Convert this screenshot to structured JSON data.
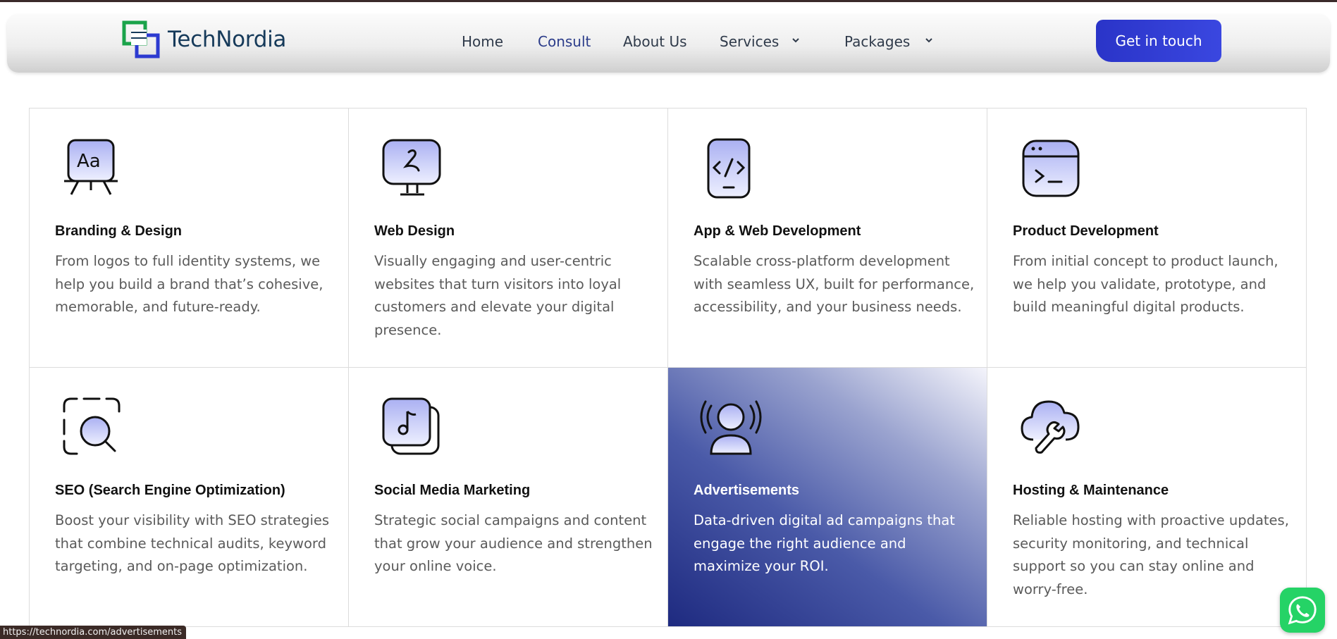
{
  "brand": {
    "name": "TechNordia"
  },
  "nav": {
    "items": [
      {
        "label": "Home",
        "active": false,
        "dropdown": false
      },
      {
        "label": "Consult",
        "active": true,
        "dropdown": false
      },
      {
        "label": "About Us",
        "active": false,
        "dropdown": false
      },
      {
        "label": "Services",
        "active": false,
        "dropdown": true
      },
      {
        "label": "Packages",
        "active": false,
        "dropdown": true
      }
    ],
    "cta_label": "Get in touch"
  },
  "services": [
    {
      "icon": "presentation-board-icon",
      "title": "Branding & Design",
      "description": "From logos to full identity systems, we help you build a brand that’s cohesive, memorable, and future-ready."
    },
    {
      "icon": "monitor-icon",
      "title": "Web Design",
      "description": "Visually engaging and user-centric websites that turn visitors into loyal customers and elevate your digital presence."
    },
    {
      "icon": "mobile-code-icon",
      "title": "App & Web Development",
      "description": "Scalable cross-platform development with seamless UX, built for performance, accessibility, and your business needs."
    },
    {
      "icon": "terminal-window-icon",
      "title": "Product Development",
      "description": "From initial concept to product launch, we help you validate, prototype, and build meaningful digital products."
    },
    {
      "icon": "scan-search-icon",
      "title": "SEO (Search Engine Optimization)",
      "description": "Boost your visibility with SEO strategies that combine technical audits, keyword targeting, and on-page optimization."
    },
    {
      "icon": "music-note-icon",
      "title": "Social Media Marketing",
      "description": "Strategic social campaigns and content that grow your audience and strengthen your online voice."
    },
    {
      "icon": "broadcast-user-icon",
      "title": "Advertisements",
      "description": "Data-driven digital ad campaigns that engage the right audience and maximize your ROI.",
      "highlighted": true
    },
    {
      "icon": "cloud-wrench-icon",
      "title": "Hosting & Maintenance",
      "description": "Reliable hosting with proactive updates, security monitoring, and technical support so you can stay online and worry-free."
    }
  ],
  "status_bar": {
    "url": "https://technordia.com/advertisements"
  },
  "colors": {
    "accent": "#2a34c8",
    "icon_fill": "#c9ccf6",
    "highlight_dark": "#1e2a80",
    "whatsapp": "#25d366"
  }
}
